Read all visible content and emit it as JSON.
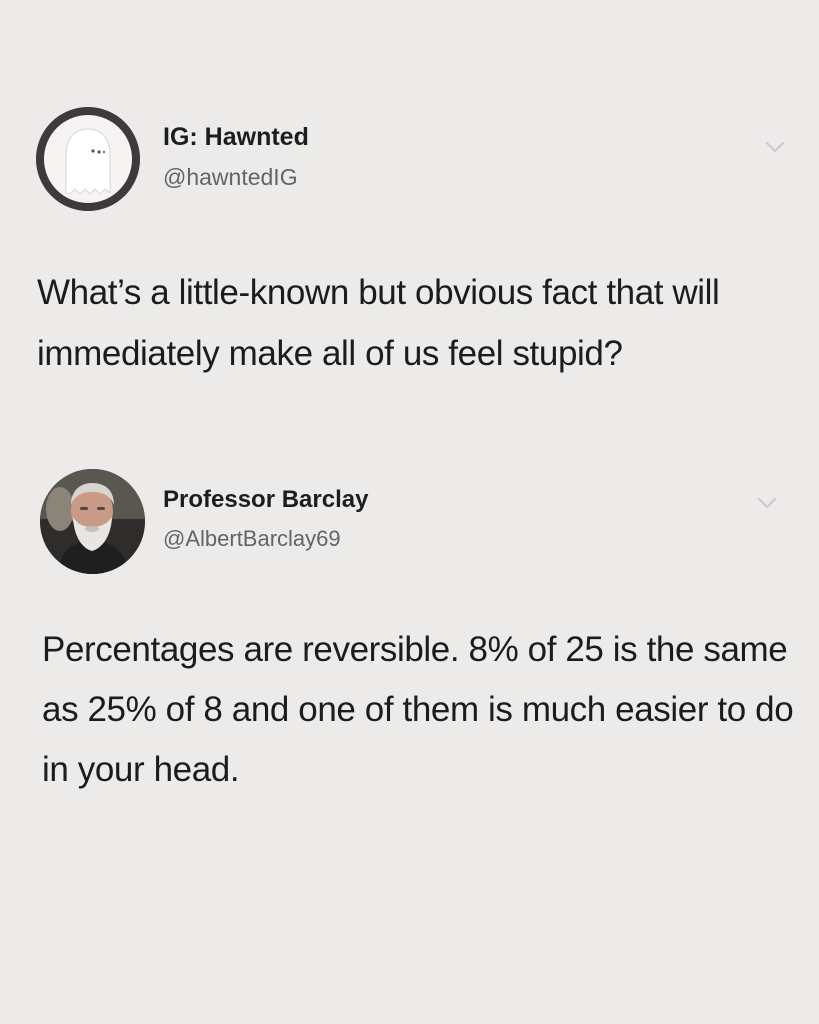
{
  "tweets": [
    {
      "author": {
        "name": "IG: Hawnted",
        "handle": "@hawntedIG",
        "avatar_icon": "ghost-icon"
      },
      "text": "What’s a little-known but obvious fact that will immediately make all of us feel stupid?",
      "menu_icon": "chevron-down-icon"
    },
    {
      "author": {
        "name": "Professor Barclay",
        "handle": "@AlbertBarclay69",
        "avatar_icon": "bearded-man-portrait"
      },
      "text": "Percentages are reversible.  8% of 25 is the same as 25% of 8 and one of them is much easier to do in your head.",
      "menu_icon": "chevron-down-icon"
    }
  ],
  "colors": {
    "background": "#ecebea",
    "name_text": "#1d1d1d",
    "handle_text": "#646464",
    "body_text": "#1c1c1c",
    "chevron": "#c9c7c7"
  }
}
